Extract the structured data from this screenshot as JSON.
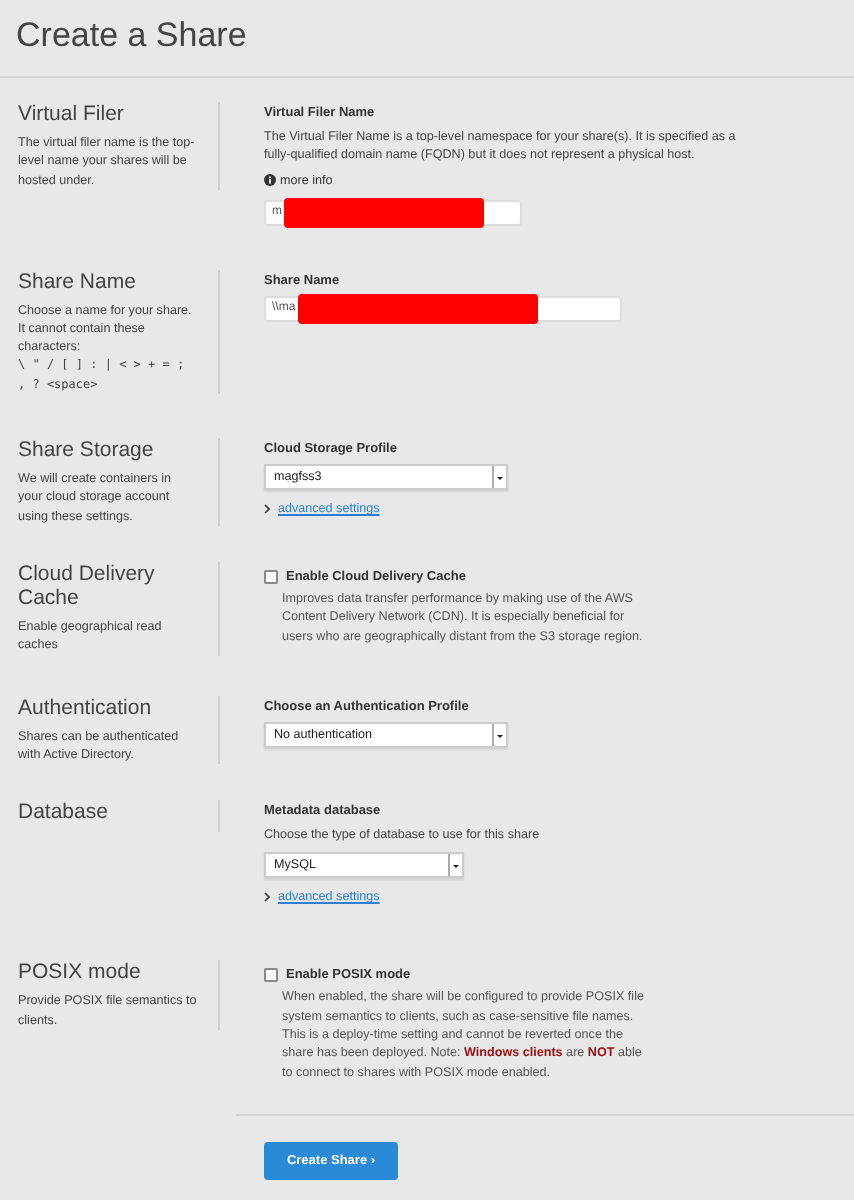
{
  "page": {
    "title": "Create a Share"
  },
  "sections": [
    {
      "title": "Virtual Filer",
      "description": "The virtual filer name is the top-level name your shares will be hosted under.",
      "items": [
        {
          "kind": "label",
          "text": "Virtual Filer Name"
        },
        {
          "kind": "text",
          "text": "The Virtual Filer Name is a top-level namespace for your share(s). It is specified as a fully-qualified domain name (FQDN) but it does not represent a physical host."
        },
        {
          "kind": "info",
          "text": "more info"
        },
        {
          "kind": "input",
          "value": "m",
          "redacted": true
        }
      ]
    },
    {
      "title": "Share Name",
      "description": "Choose a name for your share. It cannot contain these characters:",
      "code": "\\ \" / [ ] : | < > + = ; , ? <space>",
      "items": [
        {
          "kind": "label",
          "text": "Share Name"
        },
        {
          "kind": "input",
          "value": "\\\\ma",
          "redacted": true
        }
      ]
    },
    {
      "title": "Share Storage",
      "description": "We will create containers in your cloud storage account using these settings.",
      "items": [
        {
          "kind": "label",
          "text": "Cloud Storage Profile"
        },
        {
          "kind": "select",
          "value": "magfss3"
        },
        {
          "kind": "link",
          "text": "advanced settings"
        }
      ]
    },
    {
      "title": "Cloud Delivery Cache",
      "description": "Enable geographical read caches",
      "items": [
        {
          "kind": "checkbox",
          "text": "Enable Cloud Delivery Cache",
          "checked": false
        },
        {
          "kind": "note",
          "text": "Improves data transfer performance by making use of the AWS Content Delivery Network (CDN). It is especially beneficial for users who are geographically distant from the S3 storage region."
        }
      ]
    },
    {
      "title": "Authentication",
      "description": "Shares can be authenticated with Active Directory.",
      "items": [
        {
          "kind": "label",
          "text": "Choose an Authentication Profile"
        },
        {
          "kind": "select",
          "value": "No authentication"
        }
      ]
    },
    {
      "title": "Database",
      "items": [
        {
          "kind": "label",
          "text": "Metadata database"
        },
        {
          "kind": "text",
          "text": "Choose the type of database to use for this share"
        },
        {
          "kind": "select",
          "value": "MySQL"
        },
        {
          "kind": "link",
          "text": "advanced settings"
        }
      ]
    },
    {
      "title": "POSIX mode",
      "description": "Provide POSIX file semantics to clients.",
      "items": [
        {
          "kind": "checkbox",
          "text": "Enable POSIX mode",
          "checked": false
        },
        {
          "kind": "note",
          "segments": [
            {
              "text": "When enabled, the share will be configured to provide POSIX file system semantics to clients, such as case-sensitive file names. This is a deploy-time setting and cannot be reverted once the share has been deployed. Note: ",
              "warning": false
            },
            {
              "text": "Windows clients",
              "warning": true
            },
            {
              "text": " are ",
              "warning": false
            },
            {
              "text": "NOT",
              "warning": true
            },
            {
              "text": " able to connect to shares with POSIX mode enabled.",
              "warning": false
            }
          ]
        }
      ]
    }
  ],
  "submit": {
    "label": "Create Share",
    "icon": "›"
  }
}
